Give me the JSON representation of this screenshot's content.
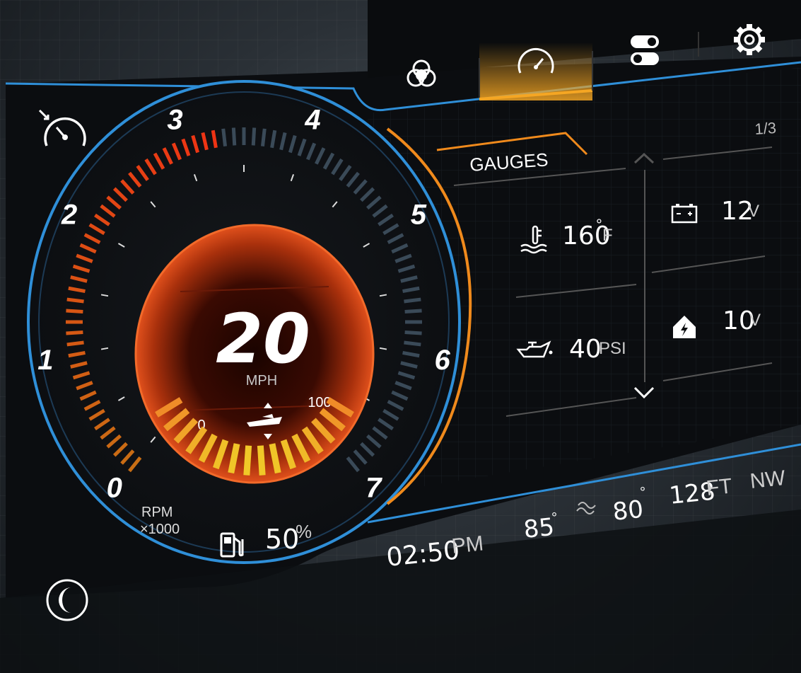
{
  "nav": {
    "tabs": [
      {
        "name": "color-filter",
        "icon": "color-circles-icon"
      },
      {
        "name": "gauges",
        "icon": "speedometer-icon",
        "active": true
      },
      {
        "name": "toggles",
        "icon": "toggle-switches-icon"
      },
      {
        "name": "settings",
        "icon": "gear-icon"
      }
    ],
    "accent": "#f5a623"
  },
  "left_controls": {
    "top_icon": "cruise-speed-icon",
    "bottom_icon": "night-mode-icon"
  },
  "tachometer": {
    "labels": [
      "0",
      "1",
      "2",
      "3",
      "4",
      "5",
      "6",
      "7"
    ],
    "unit_line1": "RPM",
    "unit_line2": "×1000",
    "rpm_level": 3.3
  },
  "speed": {
    "value": "20",
    "unit": "MPH",
    "trim_min": "0",
    "trim_max": "100",
    "trim_icon": "boat-trim-icon"
  },
  "fuel": {
    "icon": "fuel-pump-icon",
    "value": "50",
    "unit": "%"
  },
  "gauges_panel": {
    "title": "GAUGES",
    "page": "1/3",
    "items": [
      {
        "icon": "coolant-temp-icon",
        "value": "160",
        "unit_prefix": "°",
        "unit": "F"
      },
      {
        "icon": "battery-icon",
        "value": "12",
        "unit": "V"
      },
      {
        "icon": "oil-pressure-icon",
        "value": "40",
        "unit": "PSI"
      },
      {
        "icon": "house-battery-icon",
        "value": "10",
        "unit": "V"
      }
    ],
    "up_icon": "chevron-up-icon",
    "down_icon": "chevron-down-icon"
  },
  "status_bar": {
    "time": "02:50",
    "ampm": "PM",
    "air_temp": "85",
    "water_icon": "water-temp-icon",
    "water_temp": "80",
    "depth": "128",
    "depth_unit": "FT",
    "heading": "NW",
    "degree": "°"
  },
  "colors": {
    "blue": "#2f8fd8",
    "orange": "#f08a1c",
    "red": "#e0401a",
    "panel": "#0b0d10"
  }
}
